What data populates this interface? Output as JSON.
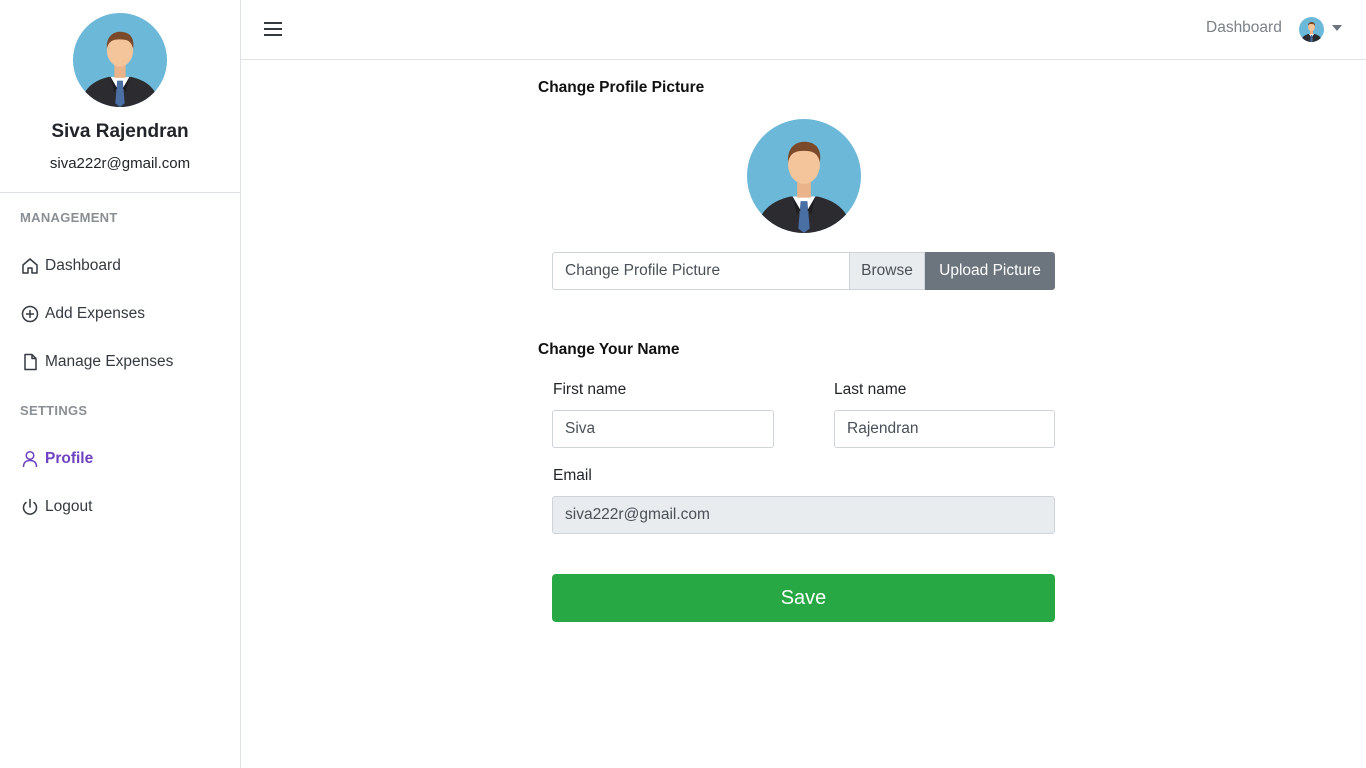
{
  "sidebar": {
    "user_name": "Siva Rajendran",
    "user_email": "siva222r@gmail.com",
    "sections": [
      {
        "heading": "MANAGEMENT",
        "items": [
          {
            "label": "Dashboard",
            "icon": "home-icon"
          },
          {
            "label": "Add Expenses",
            "icon": "plus-circle-icon"
          },
          {
            "label": "Manage Expenses",
            "icon": "file-icon"
          }
        ]
      },
      {
        "heading": "SETTINGS",
        "items": [
          {
            "label": "Profile",
            "icon": "user-icon",
            "active": true
          },
          {
            "label": "Logout",
            "icon": "power-icon"
          }
        ]
      }
    ]
  },
  "topbar": {
    "menu_icon": "hamburger-icon",
    "dashboard_link": "Dashboard",
    "avatar_icon": "avatar-icon",
    "dropdown_icon": "caret-down-icon"
  },
  "main": {
    "picture_section_title": "Change Profile Picture",
    "file_placeholder": "Change Profile Picture",
    "browse_label": "Browse",
    "upload_label": "Upload Picture",
    "name_section_title": "Change Your Name",
    "first_name_label": "First name",
    "first_name_value": "Siva",
    "last_name_label": "Last name",
    "last_name_value": "Rajendran",
    "email_label": "Email",
    "email_value": "siva222r@gmail.com",
    "save_label": "Save"
  },
  "colors": {
    "accent": "#6f42c1",
    "save": "#28a745",
    "upload": "#6c757d",
    "avatar_bg": "#6cb8d8"
  }
}
